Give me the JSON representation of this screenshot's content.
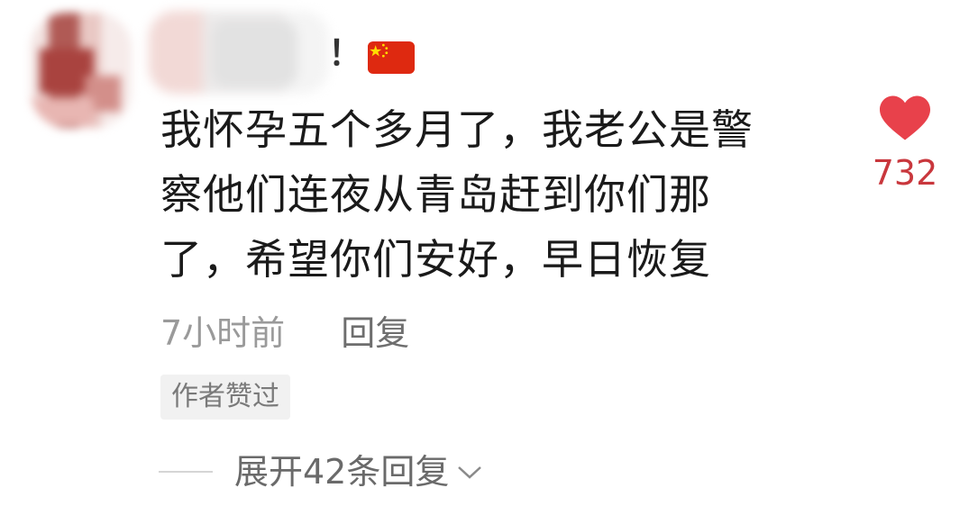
{
  "comment": {
    "username_suffix": "！",
    "text_lines": [
      "我怀孕五个多月了，我老公是警",
      "察他们连夜从青岛赶到你们那",
      "了，希望你们安好，早日恢复"
    ],
    "like_count": "732",
    "time": "7小时前",
    "reply_label": "回复",
    "author_badge": "作者赞过",
    "expand_label": "展开42条回复"
  },
  "icons": {
    "like": "heart-icon",
    "flag": "china-flag-icon",
    "expand": "chevron-down-icon"
  },
  "colors": {
    "like_heart": "#e8414b",
    "like_count": "#c9373d"
  }
}
